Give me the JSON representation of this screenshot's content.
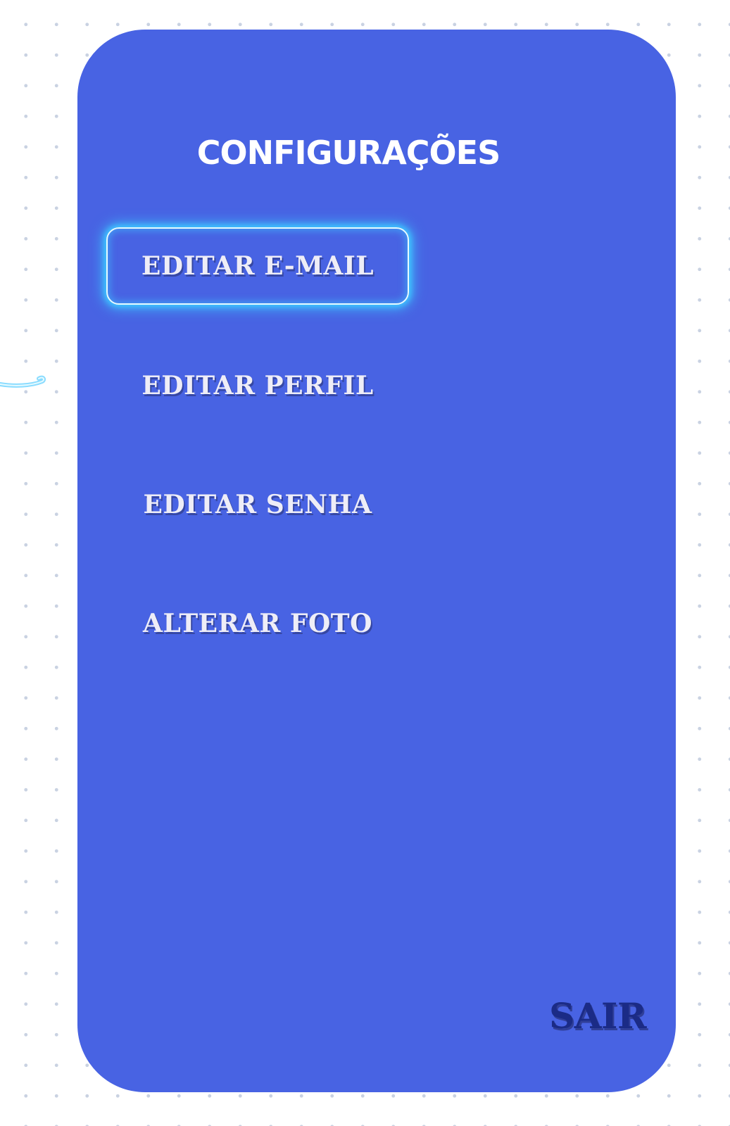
{
  "screen": {
    "title": "CONFIGURAÇÕES"
  },
  "menu": {
    "items": [
      {
        "label": "EDITAR E-MAIL",
        "active": true
      },
      {
        "label": "EDITAR PERFIL",
        "active": false
      },
      {
        "label": "EDITAR SENHA",
        "active": false
      },
      {
        "label": "ALTERAR FOTO",
        "active": false
      }
    ]
  },
  "footer": {
    "exit_label": "SAIR"
  },
  "colors": {
    "panel": "#4863e3",
    "menu_text": "#eeedf7",
    "exit_text": "#1b2b86",
    "highlight_glow": "#3ec4ff",
    "background_dots": "#c9d2e2"
  }
}
